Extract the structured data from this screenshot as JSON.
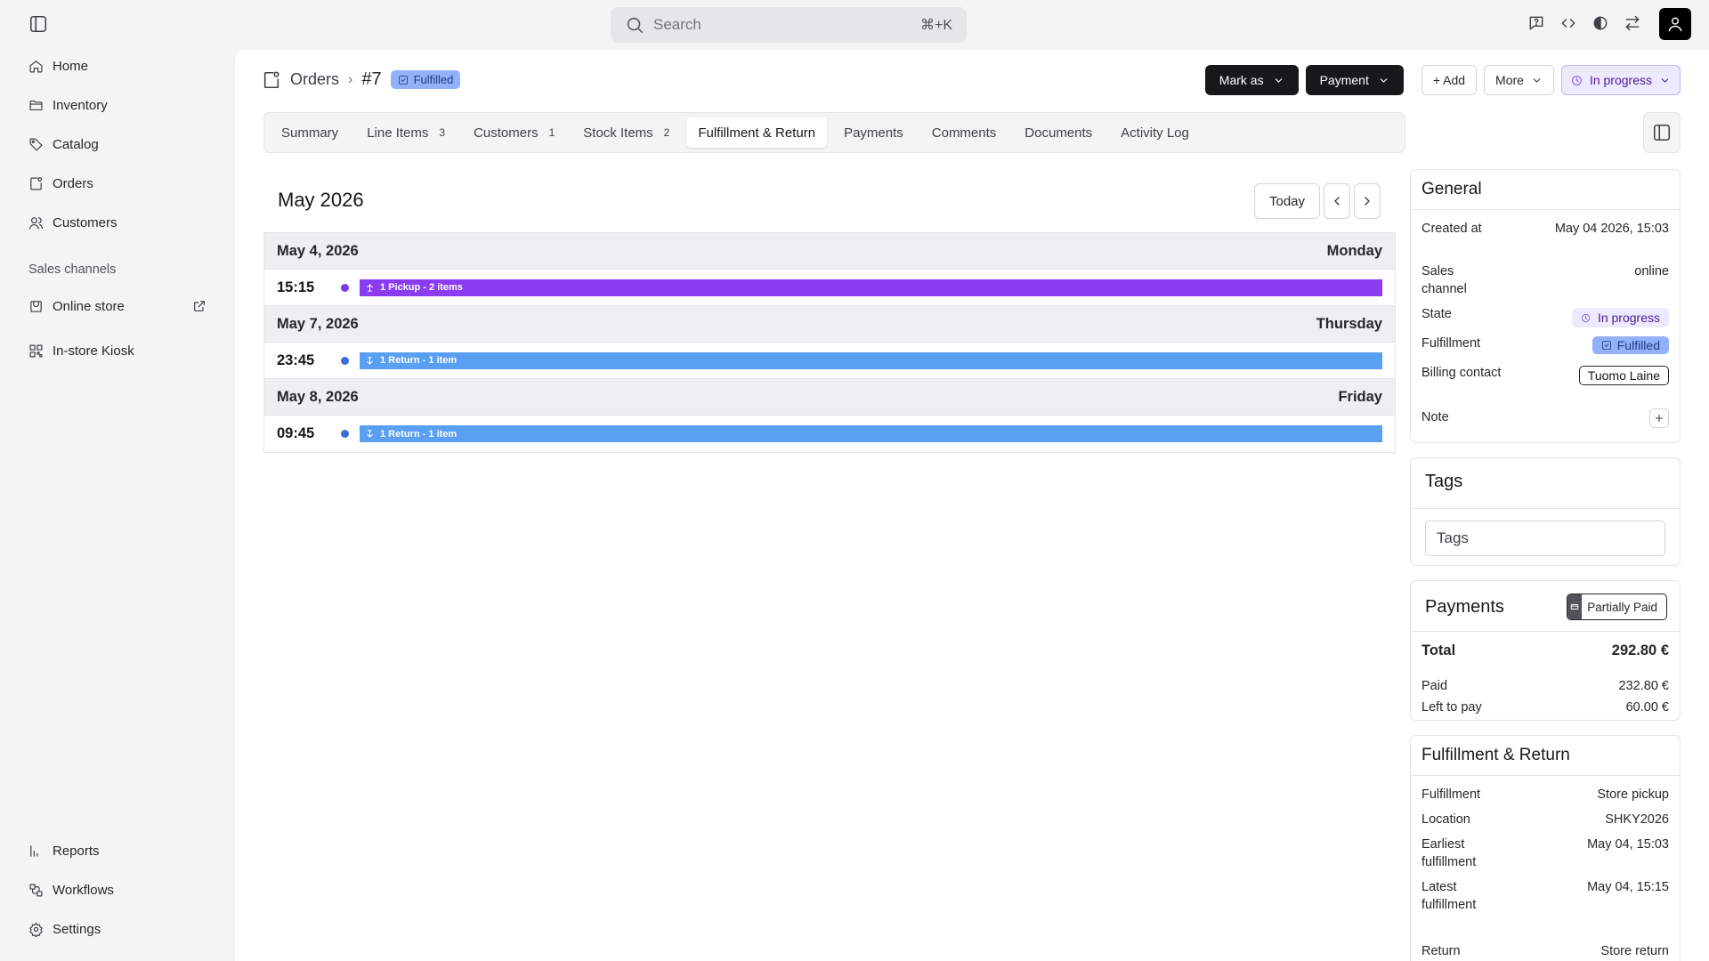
{
  "search": {
    "placeholder": "Search",
    "shortcut": "⌘+K"
  },
  "sidebar": {
    "items": [
      {
        "label": "Home",
        "icon": "home-icon"
      },
      {
        "label": "Inventory",
        "icon": "folder-icon"
      },
      {
        "label": "Catalog",
        "icon": "tag-icon"
      },
      {
        "label": "Orders",
        "icon": "orders-icon"
      },
      {
        "label": "Customers",
        "icon": "users-icon"
      }
    ],
    "section_label": "Sales channels",
    "channels": [
      {
        "label": "Online store",
        "icon": "store-icon"
      },
      {
        "label": "In-store Kiosk",
        "icon": "kiosk-icon"
      }
    ],
    "bottom": [
      {
        "label": "Reports",
        "icon": "chart-icon"
      },
      {
        "label": "Workflows",
        "icon": "workflow-icon"
      },
      {
        "label": "Settings",
        "icon": "gear-icon"
      }
    ]
  },
  "header": {
    "breadcrumb_parent": "Orders",
    "separator": "›",
    "order_id": "#7",
    "fulfillment_badge": "Fulfilled",
    "actions": {
      "mark_as": "Mark as",
      "payment": "Payment",
      "add": "+ Add",
      "more": "More",
      "state": "In progress"
    }
  },
  "tabs": [
    {
      "label": "Summary",
      "count": ""
    },
    {
      "label": "Line Items",
      "count": "3"
    },
    {
      "label": "Customers",
      "count": "1"
    },
    {
      "label": "Stock Items",
      "count": "2"
    },
    {
      "label": "Fulfillment & Return",
      "count": "",
      "active": true
    },
    {
      "label": "Payments",
      "count": ""
    },
    {
      "label": "Comments",
      "count": ""
    },
    {
      "label": "Documents",
      "count": ""
    },
    {
      "label": "Activity Log",
      "count": ""
    }
  ],
  "calendar": {
    "month": "May 2026",
    "today_label": "Today",
    "days": [
      {
        "date": "May 4, 2026",
        "weekday": "Monday",
        "time": "15:15",
        "event": "1 Pickup - 2 items",
        "color": "#8b3cf0",
        "dot": "#7c3aed",
        "kind": "pickup"
      },
      {
        "date": "May 7, 2026",
        "weekday": "Thursday",
        "time": "23:45",
        "event": "1 Return - 1 item",
        "color": "#5aa0f2",
        "dot": "#3b6fd8",
        "kind": "return"
      },
      {
        "date": "May 8, 2026",
        "weekday": "Friday",
        "time": "09:45",
        "event": "1 Return - 1 item",
        "color": "#5aa0f2",
        "dot": "#3b6fd8",
        "kind": "return"
      }
    ]
  },
  "general": {
    "title": "General",
    "created_label": "Created at",
    "created_value": "May 04 2026, 15:03",
    "channel_label": "Sales channel",
    "channel_value": "online",
    "state_label": "State",
    "state_value": "In progress",
    "fulfillment_label": "Fulfillment",
    "fulfillment_value": "Fulfilled",
    "billing_label": "Billing contact",
    "billing_value": "Tuomo Laine",
    "note_label": "Note"
  },
  "tags": {
    "title": "Tags",
    "placeholder": "Tags"
  },
  "payments": {
    "title": "Payments",
    "status": "Partially Paid",
    "total_label": "Total",
    "total_value": "292.80 €",
    "paid_label": "Paid",
    "paid_value": "232.80 €",
    "left_label": "Left to pay",
    "left_value": "60.00 €"
  },
  "fulfillment_return": {
    "title": "Fulfillment & Return",
    "rows": [
      {
        "label": "Fulfillment",
        "value": "Store pickup"
      },
      {
        "label": "Location",
        "value": "SHKY2026"
      },
      {
        "label": "Earliest fulfillment",
        "value": "May 04, 15:03"
      },
      {
        "label": "Latest fulfillment",
        "value": "May 04, 15:15"
      },
      {
        "label": "Return",
        "value": "Store return"
      }
    ]
  }
}
